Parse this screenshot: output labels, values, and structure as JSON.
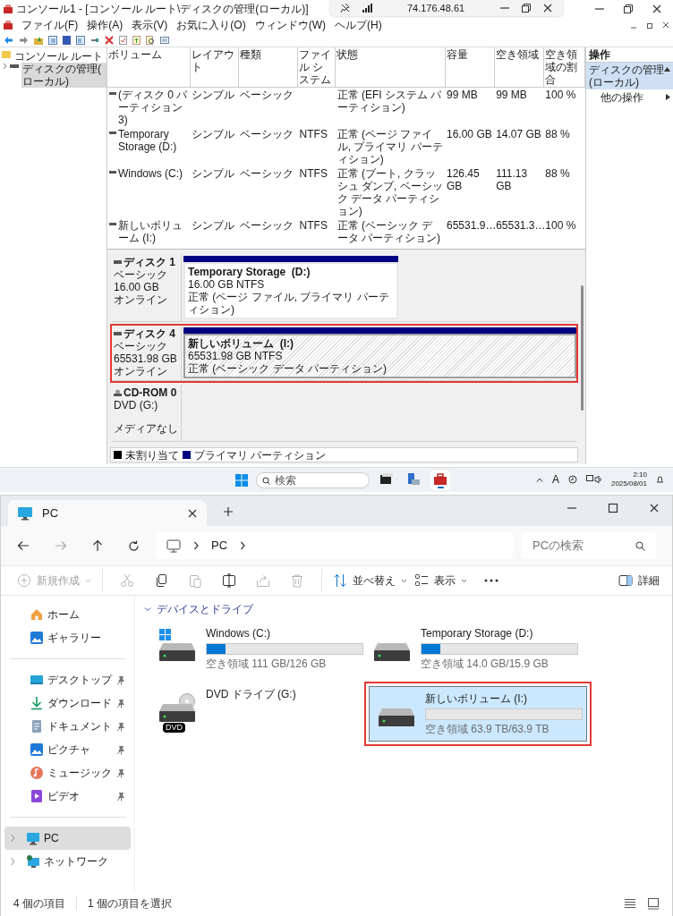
{
  "rdp_bar": {
    "address": "74.176.48.61"
  },
  "console": {
    "title": "コンソール1 - [コンソール ルート\\ディスクの管理(ローカル)]",
    "menu": [
      "ファイル(F)",
      "操作(A)",
      "表示(V)",
      "お気に入り(O)",
      "ウィンドウ(W)",
      "ヘルプ(H)"
    ],
    "tree": [
      {
        "label": "コンソール ルート",
        "selected": false,
        "children": [
          {
            "label": "ディスクの管理(ローカル)",
            "selected": true
          }
        ]
      }
    ],
    "volume_table": {
      "columns": [
        "ボリューム",
        "レイアウト",
        "種類",
        "ファイル システム",
        "状態",
        "容量",
        "空き領域",
        "空き領域の割合"
      ],
      "rows": [
        {
          "volume": "(ディスク 0 パーティション 3)",
          "layout": "シンプル",
          "type": "ベーシック",
          "status": "正常 (EFI システム パーティション)",
          "capacity": "99 MB",
          "free": "99 MB",
          "free_percent": "100 %"
        },
        {
          "volume": "Temporary Storage (D:)",
          "layout": "シンプル",
          "type": "ベーシック",
          "file_system": "NTFS",
          "status": "正常 (ページ ファイル, プライマリ パーティション)",
          "capacity": "16.00 GB",
          "free": "14.07 GB",
          "free_percent": "88 %"
        },
        {
          "volume": "Windows (C:)",
          "layout": "シンプル",
          "type": "ベーシック",
          "file_system": "NTFS",
          "status": "正常 (ブート, クラッシュ ダンプ, ベーシック データ パーティション)",
          "capacity": "126.45 GB",
          "free": "111.13 GB",
          "free_percent": "88 %"
        },
        {
          "volume": "新しいボリューム (I:)",
          "layout": "シンプル",
          "type": "ベーシック",
          "file_system": "NTFS",
          "status": "正常 (ベーシック データ パーティション)",
          "capacity": "65531.9…",
          "free": "65531.3…",
          "free_percent": "100 %"
        }
      ]
    },
    "disks": [
      {
        "kind": "disk",
        "name": "ディスク 1",
        "type": "ベーシック",
        "size": "16.00 GB",
        "state": "オンライン",
        "highlighted": false,
        "partitions": [
          {
            "name": "Temporary Storage  (D:)",
            "size": "16.00 GB NTFS",
            "status": "正常 (ページ ファイル, プライマリ パーティション)",
            "selected": false
          }
        ]
      },
      {
        "kind": "disk",
        "name": "ディスク 4",
        "type": "ベーシック",
        "size": "65531.98 GB",
        "state": "オンライン",
        "highlighted": true,
        "partitions": [
          {
            "name": "新しいボリューム  (I:)",
            "size": "65531.98 GB NTFS",
            "status": "正常 (ベーシック データ パーティション)",
            "selected": true
          }
        ]
      },
      {
        "kind": "cdrom",
        "name": "CD-ROM 0",
        "type": "DVD (G:)",
        "state": "メディアなし",
        "highlighted": false
      }
    ],
    "legend": [
      {
        "label": "未割り当て",
        "color": "#000000"
      },
      {
        "label": "プライマリ パーティション",
        "color": "#000080"
      }
    ],
    "actions": {
      "title": "操作",
      "section": "ディスクの管理(ローカル)",
      "items": [
        "他の操作"
      ]
    }
  },
  "taskbar": {
    "search_placeholder": "検索",
    "apps": [
      {
        "kind": "terminal",
        "selected": false
      },
      {
        "kind": "server",
        "selected": false
      },
      {
        "kind": "toolbox",
        "selected": true
      }
    ],
    "ime": "A",
    "time": "2:10",
    "date": "2025/08/01"
  },
  "explorer": {
    "tab": "PC",
    "breadcrumb": [
      "PC"
    ],
    "search_placeholder": "PCの検索",
    "commands": [
      {
        "kind": "new",
        "label": "新規作成",
        "disabled": true
      },
      {
        "kind": "cut",
        "disabled": true
      },
      {
        "kind": "copy",
        "disabled": false
      },
      {
        "kind": "paste",
        "disabled": true
      },
      {
        "kind": "rename",
        "disabled": false
      },
      {
        "kind": "share",
        "disabled": true
      },
      {
        "kind": "delete",
        "disabled": true
      },
      {
        "kind": "sort",
        "label": "並べ替え",
        "disabled": false
      },
      {
        "kind": "view",
        "label": "表示",
        "disabled": false
      },
      {
        "kind": "more",
        "disabled": false
      }
    ],
    "details_button": "詳細",
    "quick_access": [
      {
        "kind": "home",
        "label": "ホーム",
        "pinned": false
      },
      {
        "kind": "gallery",
        "label": "ギャラリー",
        "pinned": false
      }
    ],
    "pinned": [
      {
        "kind": "desktop",
        "label": "デスクトップ",
        "pinned": true
      },
      {
        "kind": "download",
        "label": "ダウンロード",
        "pinned": true
      },
      {
        "kind": "document",
        "label": "ドキュメント",
        "pinned": true
      },
      {
        "kind": "pictures",
        "label": "ピクチャ",
        "pinned": true
      },
      {
        "kind": "music",
        "label": "ミュージック",
        "pinned": true
      },
      {
        "kind": "video",
        "label": "ビデオ",
        "pinned": true
      }
    ],
    "locations": [
      {
        "kind": "pc",
        "label": "PC",
        "selected": true
      },
      {
        "kind": "network",
        "label": "ネットワーク",
        "selected": false
      }
    ],
    "section": {
      "title": "デバイスとドライブ",
      "expanded": true
    },
    "drives": [
      {
        "kind": "system",
        "name": "Windows (C:)",
        "level": 0.12,
        "free": "空き領域 111 GB/126 GB",
        "selected": false,
        "highlighted": false
      },
      {
        "kind": "disk",
        "name": "Temporary Storage (D:)",
        "level": 0.12,
        "free": "空き領域 14.0 GB/15.9 GB",
        "selected": false,
        "highlighted": false
      },
      {
        "kind": "dvd",
        "name": "DVD ドライブ (G:)",
        "icon_label": "DVD",
        "selected": false,
        "highlighted": false
      },
      {
        "kind": "disk",
        "name": "新しいボリューム (I:)",
        "level": 0,
        "free": "空き領域 63.9 TB/63.9 TB",
        "selected": true,
        "highlighted": true
      }
    ],
    "status": [
      "4 個の項目",
      "1 個の項目を選択"
    ]
  }
}
